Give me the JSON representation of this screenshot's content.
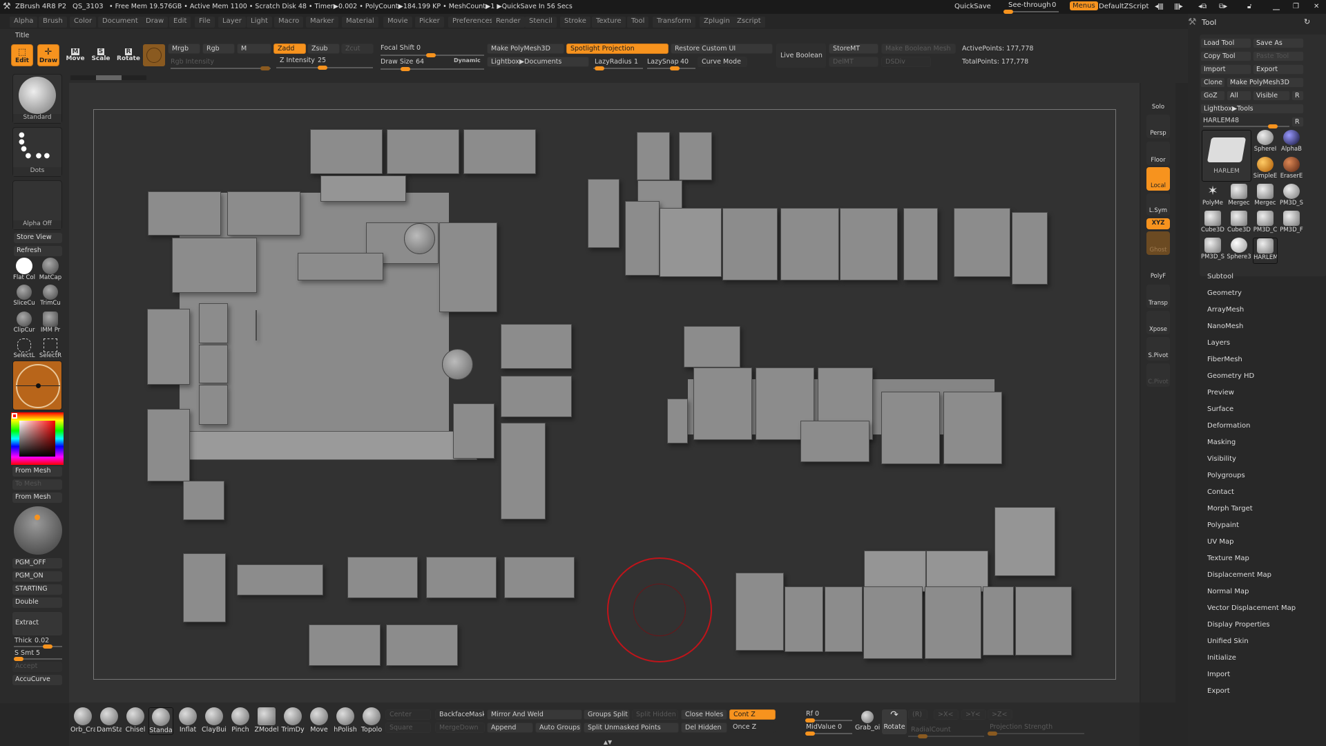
{
  "titlebar": {
    "app": "ZBrush 4R8 P2",
    "project": "QS_3103",
    "stats": "• Free Mem 19.576GB • Active Mem 1100 • Scratch Disk 48 •  Timer▶0.002 • PolyCount▶184.199 KP  • MeshCount▶1   ▶QuickSave In 56 Secs",
    "quicksave": "QuickSave",
    "see_through_label": "See-through",
    "see_through_value": "0",
    "see_through_fraction": 0.0,
    "menus_label": "Menus",
    "default_zscript": "DefaultZScript"
  },
  "menubar": [
    "Alpha",
    "Brush",
    "Color",
    "Document",
    "Draw",
    "Edit",
    "File",
    "Layer",
    "Light",
    "Macro",
    "Marker",
    "Material",
    "Movie",
    "Picker",
    "Preferences",
    "Render",
    "Stencil",
    "Stroke",
    "Texture",
    "Tool",
    "Transform",
    "Zplugin",
    "Zscript"
  ],
  "toolbar": {
    "title_label": "Title",
    "edit": "Edit",
    "draw": "Draw",
    "move": "Move",
    "scale": "Scale",
    "rotate": "Rotate",
    "mrgb": "Mrgb",
    "rgb": "Rgb",
    "m": "M",
    "zadd": "Zadd",
    "zsub": "Zsub",
    "zcut": "Zcut",
    "rgb_intensity": "Rgb Intensity",
    "z_intensity_label": "Z Intensity",
    "z_intensity": "25",
    "focal_shift_label": "Focal Shift",
    "focal_shift": "0",
    "draw_size_label": "Draw Size",
    "draw_size": "64",
    "dynamic": "Dynamic",
    "make_polymesh3d": "Make PolyMesh3D",
    "spotlight_projection": "Spotlight Projection",
    "restore_custom_ui": "Restore Custom UI",
    "lightbox_documents": "Lightbox▶Documents",
    "lazy_radius_label": "LazyRadius",
    "lazy_radius": "1",
    "lazy_snap_label": "LazySnap",
    "lazy_snap": "40",
    "curve_mode": "Curve Mode",
    "live_boolean": "Live Boolean",
    "store_mt": "StoreMT",
    "del_mt": "DelMT",
    "make_boolean_mesh": "Make Boolean Mesh",
    "dsdiv": "DSDiv",
    "active_points": "ActivePoints: 177,778",
    "total_points": "TotalPoints: 177,778"
  },
  "left_shelf": {
    "brush_thumb": "Standard",
    "stroke_thumb": "Dots",
    "alpha_thumb": "Alpha Off",
    "store_view": "Store View",
    "refresh": "Refresh",
    "materials": [
      "Flat Col",
      "MatCap"
    ],
    "tools_row1": [
      "SliceCu",
      "TrimCu"
    ],
    "tools_row2": [
      "ClipCur",
      "IMM Pr"
    ],
    "tools_row3": [
      "SelectL",
      "SelectR"
    ],
    "from_mesh_1": "From Mesh",
    "to_mesh": "To Mesh",
    "from_mesh_2": "From Mesh",
    "pgm_off": "PGM_OFF",
    "pgm_on": "PGM_ON",
    "starting": "STARTING",
    "double": "Double",
    "extract": "Extract",
    "thick_label": "Thick",
    "thick": "0.02",
    "s_smt_label": "S Smt",
    "s_smt": "5",
    "accept": "Accept",
    "accucurve": "AccuCurve",
    "main_color": "#ff0000"
  },
  "right_shelf": [
    "Solo",
    "Persp",
    "Floor",
    "Local",
    "L.Sym",
    "XYZ",
    "Ghost",
    "PolyF",
    "Transp",
    "Xpose",
    "S.Pivot",
    "C.Pivot"
  ],
  "tool_palette": {
    "title": "Tool",
    "load_tool": "Load Tool",
    "save_as": "Save As",
    "copy_tool": "Copy Tool",
    "paste_tool": "Paste Tool",
    "import": "Import",
    "export": "Export",
    "clone": "Clone",
    "make_polymesh3d": "Make PolyMesh3D",
    "goz": "GoZ",
    "all": "All",
    "visible": "Visible",
    "r": "R",
    "lightbox_tools": "Lightbox▶Tools",
    "current_tool_label": "HARLEM.",
    "current_tool_value": "48",
    "current_tool_name": "HARLEM",
    "tool_icons": [
      "SphereI",
      "AlphaB",
      "SimpleE",
      "EraserE",
      "PolyMe",
      "Mergec",
      "Mergec",
      "PM3D_S",
      "Cube3D",
      "Cube3D",
      "PM3D_C",
      "PM3D_F",
      "PM3D_S",
      "Sphere3",
      "HARLEM"
    ],
    "subpalettes": [
      "Subtool",
      "Geometry",
      "ArrayMesh",
      "NanoMesh",
      "Layers",
      "FiberMesh",
      "Geometry HD",
      "Preview",
      "Surface",
      "Deformation",
      "Masking",
      "Visibility",
      "Polygroups",
      "Contact",
      "Morph Target",
      "Polypaint",
      "UV Map",
      "Texture Map",
      "Displacement Map",
      "Normal Map",
      "Vector Displacement Map",
      "Display Properties",
      "Unified Skin",
      "Initialize",
      "Import",
      "Export"
    ]
  },
  "bottom_shelf": {
    "brushes": [
      "Orb_Cra",
      "DamSta",
      "Chisel",
      "Standa",
      "Inflat",
      "ClayBui",
      "Pinch",
      "ZModel",
      "TrimDy",
      "Move",
      "hPolish",
      "Topolo"
    ],
    "selected_brush": "Standa",
    "center": "Center",
    "square": "Square",
    "backface_mask": "BackfaceMask",
    "merge_down": "MergeDown",
    "mirror_and_weld": "Mirror And Weld",
    "append": "Append",
    "auto_groups": "Auto Groups",
    "groups_split": "Groups Split",
    "split_hidden": "Split Hidden",
    "split_unmasked_points": "Split Unmasked Points",
    "close_holes": "Close Holes",
    "del_hidden": "Del Hidden",
    "cont_z": "Cont Z",
    "once_z": "Once Z",
    "rf_label": "Rf",
    "rf": "0",
    "midvalue_label": "MidValue",
    "midvalue": "0",
    "grab": "Grab_oi",
    "rotate": "Rotate",
    "r": "(R)",
    "x": ">X<",
    "y": ">Y<",
    "z": ">Z<",
    "radial_count": "RadialCount",
    "projection_strength": "Projection Strength"
  },
  "colors": {
    "accent": "#f7931e",
    "brush_cursor": "#c0141a"
  }
}
